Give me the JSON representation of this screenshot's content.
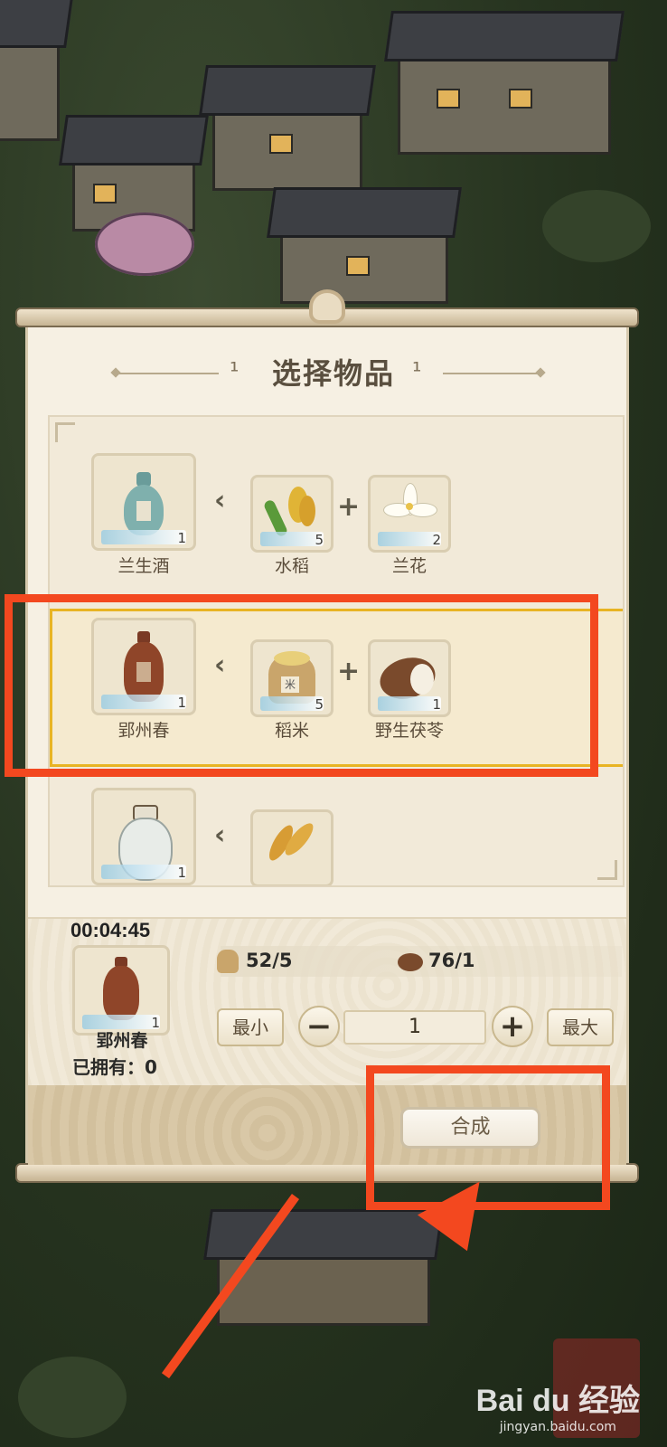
{
  "dialog": {
    "title": "选择物品"
  },
  "recipes": [
    {
      "product": {
        "name": "兰生酒",
        "count": "1",
        "icon": "wine-bottle-blue-icon"
      },
      "ingredients": [
        {
          "name": "水稻",
          "count": "5",
          "icon": "rice-plant-icon"
        },
        {
          "name": "兰花",
          "count": "2",
          "icon": "orchid-flower-icon"
        }
      ]
    },
    {
      "product": {
        "name": "郢州春",
        "count": "1",
        "icon": "wine-jar-brown-icon"
      },
      "ingredients": [
        {
          "name": "稻米",
          "count": "5",
          "icon": "rice-sack-icon"
        },
        {
          "name": "野生茯苓",
          "count": "1",
          "icon": "poria-mushroom-icon"
        }
      ],
      "selected": true
    },
    {
      "product": {
        "name": "",
        "count": "1",
        "icon": "white-wine-jug-icon"
      },
      "ingredients": [
        {
          "name": "",
          "count": "",
          "icon": "wheat-ear-icon"
        }
      ]
    }
  ],
  "craft": {
    "timer": "00:04:45",
    "selected_item": {
      "name": "郢州春",
      "count": "1"
    },
    "owned_label": "已拥有：0",
    "resources": [
      {
        "icon": "rice-sack-icon",
        "value": "52/5"
      },
      {
        "icon": "poria-mushroom-icon",
        "value": "76/1"
      }
    ],
    "min_label": "最小",
    "max_label": "最大",
    "quantity": "1",
    "craft_label": "合成"
  },
  "watermark": {
    "brand": "Bai du 经验",
    "url": "jingyan.baidu.com"
  },
  "colors": {
    "annotation": "#f3481f",
    "selected_border": "#e8b423",
    "paper": "#f6f0e3"
  }
}
